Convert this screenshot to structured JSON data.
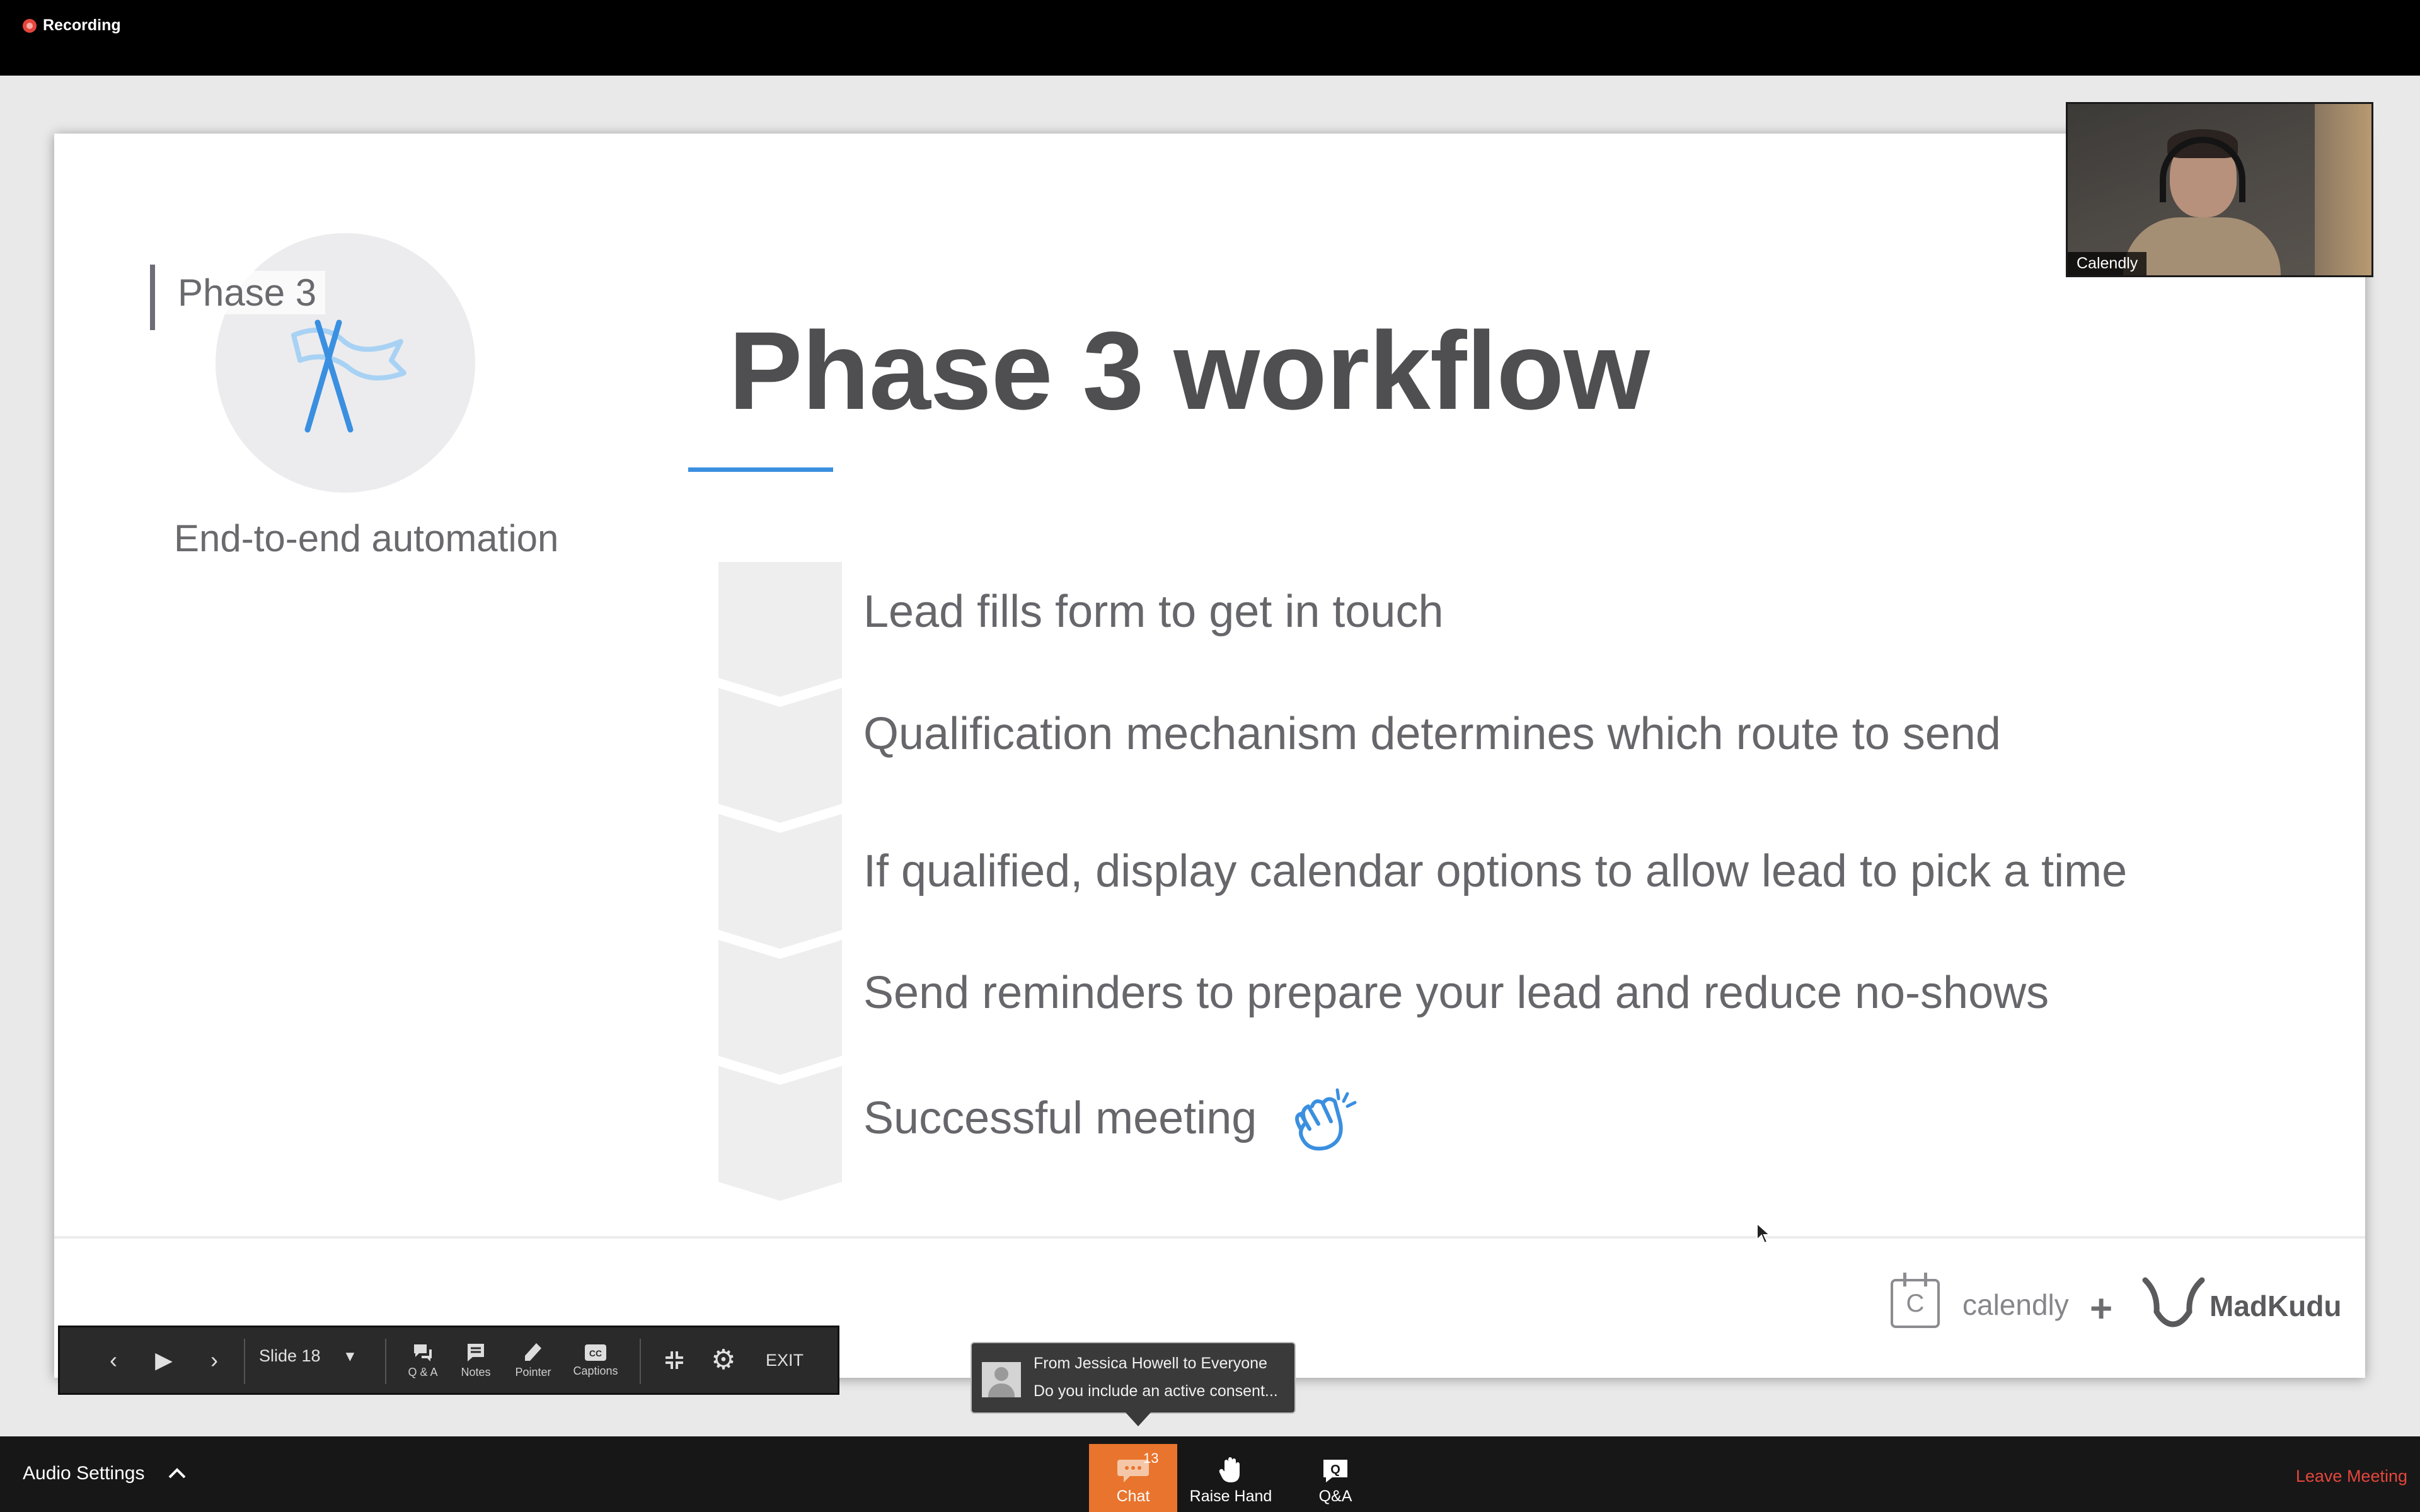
{
  "top_bar": {
    "recording_label": "Recording"
  },
  "slide": {
    "phase_label": "Phase 3",
    "phase_subtitle": "End-to-end automation",
    "title": "Phase 3 workflow",
    "steps": [
      "Lead fills form to get in touch",
      "Qualification mechanism determines which route to send",
      "If qualified, display calendar options to allow lead to pick a time",
      "Send reminders to prepare your lead and reduce no-shows",
      "Successful meeting"
    ],
    "footer": {
      "calendly_icon_letter": "C",
      "calendly": "calendly",
      "plus": "+",
      "madkudu": "MadKudu"
    },
    "colors": {
      "accent_blue": "#3a8fe0",
      "text_gray": "#66666b"
    }
  },
  "video": {
    "participant_name": "Calendly"
  },
  "presenter_toolbar": {
    "slide_label": "Slide 18",
    "qa": "Q & A",
    "notes": "Notes",
    "pointer": "Pointer",
    "captions": "Captions",
    "exit": "EXIT"
  },
  "chat_toast": {
    "from": "From Jessica Howell to Everyone",
    "message": "Do you include an active consent..."
  },
  "bottom_bar": {
    "audio_settings": "Audio Settings",
    "chat": "Chat",
    "chat_count": "13",
    "raise_hand": "Raise Hand",
    "qa": "Q&A",
    "leave": "Leave Meeting",
    "chat_color": "#e9742d",
    "leave_color": "#e5463c"
  }
}
